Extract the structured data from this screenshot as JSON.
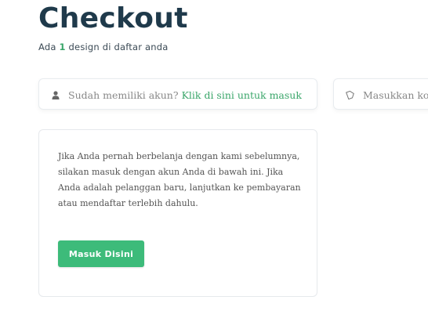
{
  "header": {
    "title": "Checkout",
    "subtitle_prefix": "Ada",
    "design_count": "1",
    "subtitle_suffix": "design di daftar anda"
  },
  "login_notice": {
    "icon": "user-icon",
    "text": "Sudah memiliki akun?",
    "link_label": "Klik di sini untuk masuk"
  },
  "coupon_notice": {
    "icon": "tag-icon",
    "text": "Masukkan kod"
  },
  "info_card": {
    "body": "Jika Anda pernah berbelanja dengan kami sebelumnya, silakan masuk dengan akun Anda di bawah ini. Jika Anda adalah pelanggan baru, lanjutkan ke pembayaran atau mendaftar terlebih dahulu.",
    "button_label": "Masuk Disini"
  },
  "colors": {
    "title": "#1f3a4b",
    "accent_green": "#3aa66a",
    "button_green": "#3dbb7a"
  }
}
